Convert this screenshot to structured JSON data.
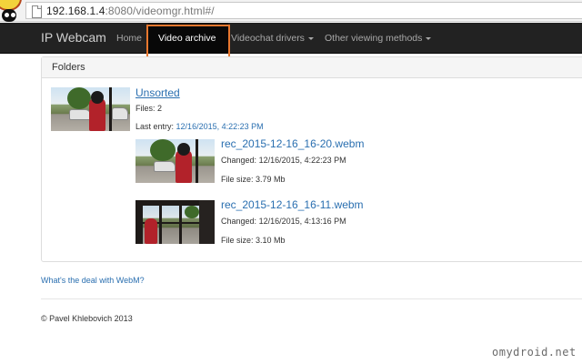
{
  "browser": {
    "url_host": "192.168.1.4",
    "url_rest": ":8080/videomgr.html#/"
  },
  "navbar": {
    "brand": "IP Webcam",
    "items": [
      {
        "label": "Home",
        "dropdown": false,
        "active": false
      },
      {
        "label": "Video archive",
        "dropdown": false,
        "active": true
      },
      {
        "label": "Videochat drivers",
        "dropdown": true,
        "active": false
      },
      {
        "label": "Other viewing methods",
        "dropdown": true,
        "active": false
      }
    ]
  },
  "panel": {
    "heading": "Folders",
    "folder": {
      "name": "Unsorted",
      "files_label": "Files: 2",
      "last_entry_label": "Last entry:",
      "last_entry_value": "12/16/2015, 4:22:23 PM",
      "files": [
        {
          "name": "rec_2015-12-16_16-20.webm",
          "changed_label": "Changed:",
          "changed_value": "12/16/2015, 4:22:23 PM",
          "size_label": "File size:",
          "size_value": "3.79 Mb"
        },
        {
          "name": "rec_2015-12-16_16-11.webm",
          "changed_label": "Changed:",
          "changed_value": "12/16/2015, 4:13:16 PM",
          "size_label": "File size:",
          "size_value": "3.10 Mb"
        }
      ]
    }
  },
  "links": {
    "webm": "What's the deal with WebM?"
  },
  "footer": {
    "copyright": "© Pavel Khlebovich 2013"
  },
  "watermark": "omydroid.net",
  "colors": {
    "navbar_bg": "#222222",
    "link": "#2a6fb0",
    "highlight": "#e8772e"
  }
}
